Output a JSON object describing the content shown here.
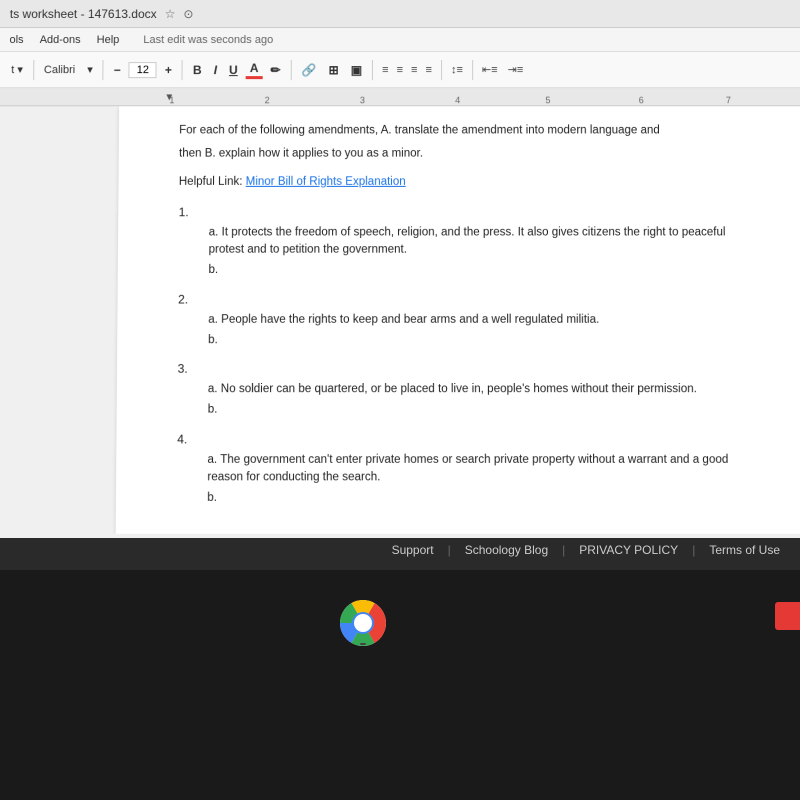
{
  "titleBar": {
    "title": "ts worksheet - 147613.docx",
    "starIcon": "★",
    "cloudIcon": "☁"
  },
  "menuBar": {
    "items": [
      "ols",
      "Add-ons",
      "Help"
    ],
    "lastEdit": "Last edit was seconds ago"
  },
  "toolbar": {
    "fontName": "Calibri",
    "fontSize": "12",
    "boldLabel": "B",
    "italicLabel": "I",
    "underlineLabel": "U",
    "colorLabel": "A",
    "minus": "−",
    "plus": "+"
  },
  "ruler": {
    "numbers": [
      "1",
      "2",
      "3",
      "4",
      "5",
      "6",
      "7"
    ]
  },
  "document": {
    "intro": "For each of the following amendments, A. translate the amendment into modern language and",
    "subtitle": "then B. explain how it applies to you as a minor.",
    "helpfulLinkLabel": "Helpful Link:",
    "helpfulLinkText": "Minor Bill of Rights Explanation",
    "items": [
      {
        "number": "1.",
        "subA": "It protects the freedom of speech, religion, and the press. It also gives citizens the right to peaceful protest and to petition the government.",
        "subBLabel": "b."
      },
      {
        "number": "2.",
        "subA": "People have the rights to keep and bear arms and a well regulated militia.",
        "subBLabel": "b."
      },
      {
        "number": "3.",
        "subA": "No soldier can be quartered, or be placed to live in, people's homes without their permission.",
        "subBLabel": "b."
      },
      {
        "number": "4.",
        "subA": "The government can't enter private homes or search private property without a warrant and a good reason for conducting the search.",
        "subBLabel": "b."
      }
    ]
  },
  "footer": {
    "supportLabel": "Support",
    "blogLabel": "Schoology Blog",
    "privacyLabel": "PRIVACY POLICY",
    "termsLabel": "Terms of Use",
    "separators": [
      "|",
      "|",
      "|"
    ]
  }
}
